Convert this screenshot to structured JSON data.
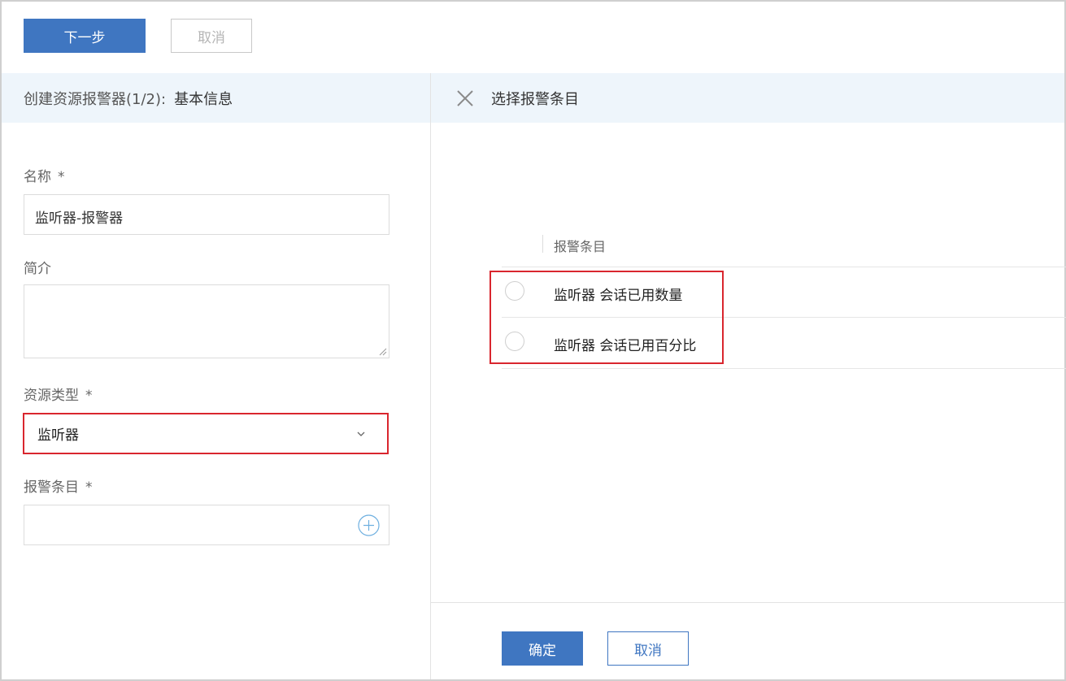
{
  "toolbar": {
    "next_label": "下一步",
    "cancel_label": "取消"
  },
  "left_panel": {
    "header_prefix": "创建资源报警器(1/2):",
    "header_step": "基本信息",
    "fields": {
      "name_label": "名称",
      "name_value": "监听器-报警器",
      "desc_label": "简介",
      "resource_type_label": "资源类型",
      "resource_type_value": "监听器",
      "alarm_items_label": "报警条目",
      "required_mark": "*"
    }
  },
  "right_panel": {
    "title": "选择报警条目",
    "column_header": "报警条目",
    "rows": [
      {
        "label": "监听器 会话已用数量"
      },
      {
        "label": "监听器 会话已用百分比"
      }
    ],
    "ok_label": "确定",
    "cancel_label": "取消"
  },
  "colors": {
    "primary": "#3f76c1",
    "highlight_border": "#d9262e",
    "header_bg": "#eef5fb"
  },
  "icons": {
    "close": "close-icon",
    "dropdown": "chevron-down-icon",
    "add": "plus-circle-icon"
  }
}
